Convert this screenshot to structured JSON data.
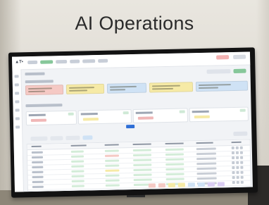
{
  "scene": {
    "sign_title": "AI Operations"
  },
  "colors": {
    "wall": "#e9e6df",
    "title_text": "#2a2a2a",
    "monitor_bezel": "#121212",
    "app_background": "#f1f3f6",
    "accent_green": "#86c79a",
    "accent_blue": "#2f6fd6",
    "accent_red": "#f0b7b7",
    "card_yellow": "#f6eaa6",
    "card_blue": "#cfe2f5",
    "card_red": "#f5c9c4",
    "card_green": "#d3ecd8"
  },
  "screen": {
    "status_cards": [
      {
        "tone": "card_red"
      },
      {
        "tone": "card_yellow"
      },
      {
        "tone": "card_blue"
      },
      {
        "tone": "card_yellow"
      },
      {
        "tone": "card_blue"
      }
    ],
    "groups": [
      {
        "id": "g1"
      },
      {
        "id": "g2"
      },
      {
        "id": "g3"
      },
      {
        "id": "g4"
      }
    ],
    "table_rows": 8
  }
}
